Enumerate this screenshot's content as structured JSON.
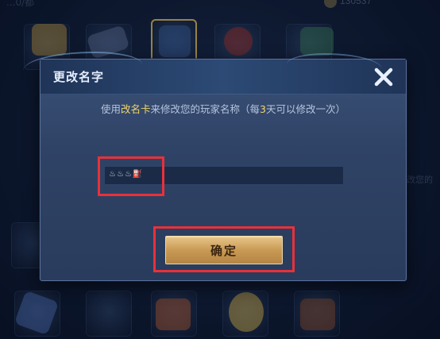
{
  "background": {
    "top_left_text": "...0/都",
    "coin_count": "130537",
    "side_text": "改您的"
  },
  "dialog": {
    "title": "更改名字",
    "instruction": {
      "prefix": "使用",
      "item": "改名卡",
      "middle": "来修改您的玩家名称（每",
      "days": "3",
      "suffix": "天可以修改一次）"
    },
    "name_value": "",
    "name_icons": [
      "♨",
      "♨",
      "♨",
      "⛽"
    ],
    "confirm_label": "确定",
    "close_icon": "close-icon"
  },
  "colors": {
    "highlight": "#f2d76a",
    "annotation": "#e8313a",
    "button_gold": "#c99a55"
  }
}
